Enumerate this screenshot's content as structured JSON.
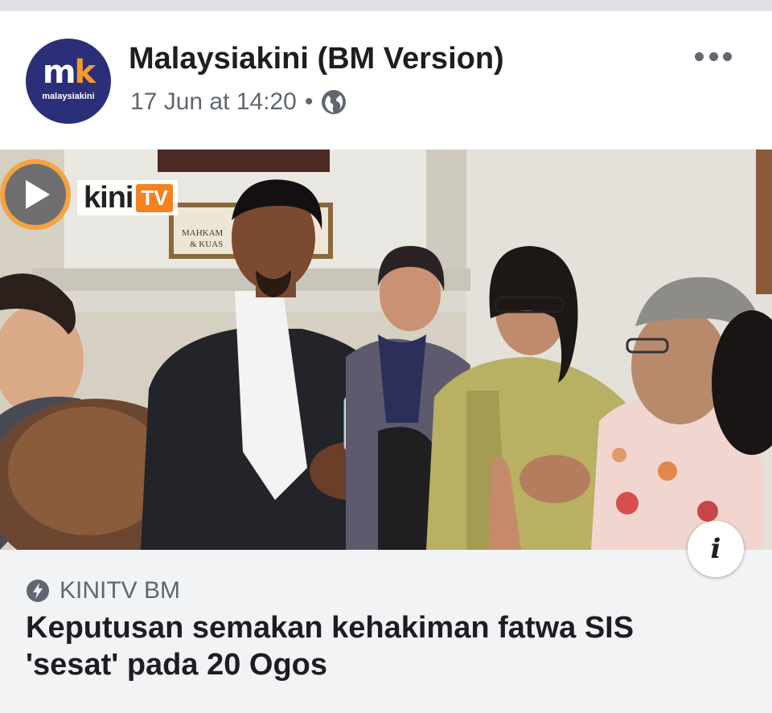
{
  "post": {
    "page_name": "Malaysiakini (BM Version)",
    "timestamp": "17 Jun at 14:20",
    "separator": "•",
    "privacy_icon": "globe-icon",
    "more_icon": "more-horizontal-icon"
  },
  "avatar": {
    "logo_m": "m",
    "logo_k": "k",
    "logo_text": "malaysiakini"
  },
  "media": {
    "play_icon": "play-icon",
    "overlay_brand": "kini",
    "overlay_brand_tv": "TV",
    "sign_line1": "MAHKAM",
    "sign_line2": "& KUAS",
    "info_icon": "info-icon",
    "info_label": "i"
  },
  "link_preview": {
    "source_icon": "lightning-bolt-icon",
    "source": "KINITV BM",
    "headline": "Keputusan semakan kehakiman fatwa SIS 'sesat' pada 20 Ogos"
  },
  "colors": {
    "avatar_bg": "#2b2f7a",
    "avatar_accent": "#f39a2b",
    "footer_bg": "#f2f3f5",
    "meta_text": "#606770",
    "tv_badge": "#f58220"
  }
}
